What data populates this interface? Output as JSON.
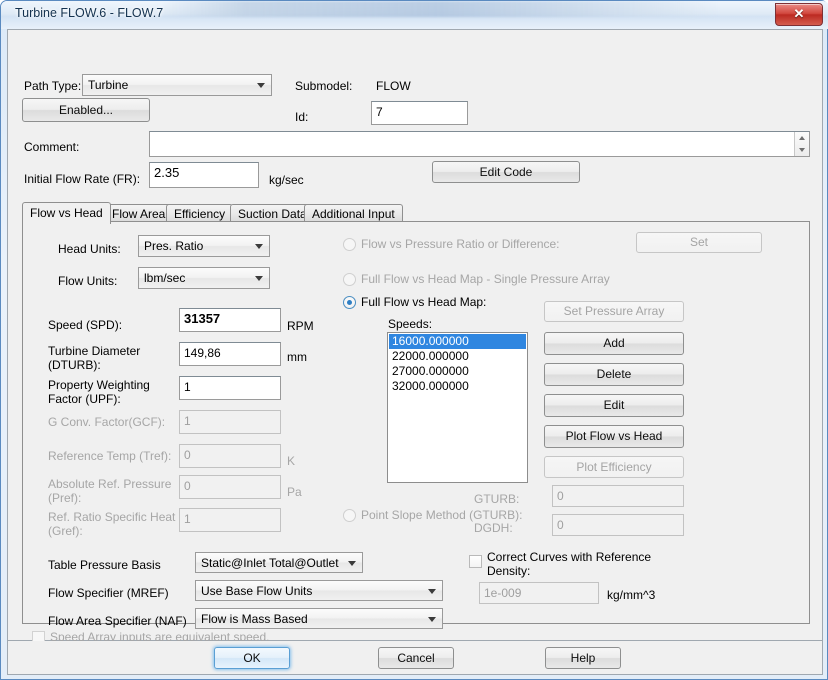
{
  "window": {
    "title": "Turbine FLOW.6 - FLOW.7",
    "close_label": "✕"
  },
  "header": {
    "path_type_label": "Path Type:",
    "path_type_value": "Turbine",
    "submodel_label": "Submodel:",
    "submodel_value": "FLOW",
    "enabled_button": "Enabled...",
    "id_label": "Id:",
    "id_value": "7",
    "comment_label": "Comment:",
    "comment_value": "",
    "initial_flow_label": "Initial Flow Rate (FR):",
    "initial_flow_value": "2.35",
    "initial_flow_units": "kg/sec",
    "edit_code_button": "Edit Code"
  },
  "tabs": [
    {
      "label": "Flow vs Head",
      "selected": true
    },
    {
      "label": "Flow Area",
      "selected": false
    },
    {
      "label": "Efficiency",
      "selected": false
    },
    {
      "label": "Suction Data",
      "selected": false
    },
    {
      "label": "Additional Input",
      "selected": false
    }
  ],
  "left_panel": {
    "head_units_label": "Head Units:",
    "head_units_value": "Pres. Ratio",
    "flow_units_label": "Flow Units:",
    "flow_units_value": "lbm/sec",
    "fields": [
      {
        "label": "Speed (SPD):",
        "value": "31357",
        "units": "RPM",
        "disabled": false
      },
      {
        "label": "Turbine Diameter\n(DTURB):",
        "value": "149,86",
        "units": "mm",
        "disabled": false
      },
      {
        "label": "Property Weighting\nFactor (UPF):",
        "value": "1",
        "units": "",
        "disabled": false
      },
      {
        "label": "G Conv. Factor(GCF):",
        "value": "1",
        "units": "",
        "disabled": true
      },
      {
        "label": "Reference Temp (Tref):",
        "value": "0",
        "units": "K",
        "disabled": true
      },
      {
        "label": "Absolute Ref. Pressure\n(Pref):",
        "value": "0",
        "units": "Pa",
        "disabled": true
      },
      {
        "label": "Ref. Ratio Specific Heat\n(Gref):",
        "value": "1",
        "units": "",
        "disabled": true
      }
    ],
    "table_pressure_basis_label": "Table Pressure Basis",
    "table_pressure_basis_value": "Static@Inlet Total@Outlet",
    "flow_specifier_label": "Flow Specifier (MREF)",
    "flow_specifier_value": "Use Base Flow Units",
    "flow_area_specifier_label": "Flow Area Specifier (NAF)",
    "flow_area_specifier_value": "Flow is Mass Based",
    "speed_array_checkbox_label": "Speed Array inputs are equivalent speed.",
    "speed_array_checked": false
  },
  "right_panel": {
    "radios": [
      {
        "label": "Flow vs Pressure Ratio or Difference:",
        "selected": false,
        "disabled": true
      },
      {
        "label": "Full Flow vs Head  Map - Single Pressure Array",
        "selected": false,
        "disabled": true
      },
      {
        "label": "Full Flow vs Head Map:",
        "selected": true,
        "disabled": false
      },
      {
        "label": "Point Slope Method (GTURB):",
        "selected": false,
        "disabled": true
      }
    ],
    "set_button": "Set",
    "speeds_label": "Speeds:",
    "speeds": [
      "16000.000000",
      "22000.000000",
      "27000.000000",
      "32000.000000"
    ],
    "selected_speed_index": 0,
    "buttons": [
      {
        "label": "Set Pressure Array",
        "disabled": true
      },
      {
        "label": "Add",
        "disabled": false
      },
      {
        "label": "Delete",
        "disabled": false
      },
      {
        "label": "Edit",
        "disabled": false
      },
      {
        "label": "Plot Flow vs Head",
        "disabled": false
      },
      {
        "label": "Plot Efficiency",
        "disabled": true
      }
    ],
    "gturb_label": "GTURB:",
    "gturb_value": "0",
    "dgdh_label": "DGDH:",
    "dgdh_value": "0",
    "correct_curves_label": "Correct Curves with Reference\nDensity:",
    "correct_curves_checked": false,
    "density_value": "1e-009",
    "density_units": "kg/mm^3"
  },
  "footer": {
    "ok_label": "OK",
    "cancel_label": "Cancel",
    "help_label": "Help"
  },
  "colors": {
    "accent": "#2f86e0",
    "close": "#bc2a22",
    "panel": "#f0f0f0"
  }
}
